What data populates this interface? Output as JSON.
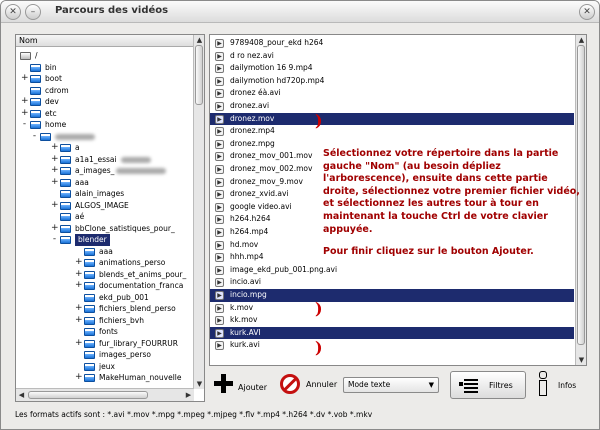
{
  "window": {
    "title": "Parcours des vidéos"
  },
  "tree": {
    "header": "Nom",
    "items": [
      {
        "label": "/",
        "level": 0,
        "exp": "-",
        "root": true
      },
      {
        "label": "bin",
        "level": 1,
        "exp": ""
      },
      {
        "label": "boot",
        "level": 1,
        "exp": "+"
      },
      {
        "label": "cdrom",
        "level": 1,
        "exp": ""
      },
      {
        "label": "dev",
        "level": 1,
        "exp": "+"
      },
      {
        "label": "etc",
        "level": 1,
        "exp": "+"
      },
      {
        "label": "home",
        "level": 1,
        "exp": "-"
      },
      {
        "label": "",
        "level": 2,
        "exp": "-",
        "blur": 40
      },
      {
        "label": "a",
        "level": 3,
        "exp": "+"
      },
      {
        "label": "a1a1_essai",
        "level": 3,
        "exp": "+",
        "blur": 30
      },
      {
        "label": "a_images_",
        "level": 3,
        "exp": "+",
        "blur": 50
      },
      {
        "label": "aaa",
        "level": 3,
        "exp": "+"
      },
      {
        "label": "alain_images",
        "level": 3,
        "exp": ""
      },
      {
        "label": "ALGOS_IMAGE",
        "level": 3,
        "exp": "+"
      },
      {
        "label": "aé",
        "level": 3,
        "exp": ""
      },
      {
        "label": "bbClone_satistiques_pour_",
        "level": 3,
        "exp": "+"
      },
      {
        "label": "blender",
        "level": 3,
        "exp": "-",
        "sel": true
      },
      {
        "label": "aaa",
        "level": 4,
        "exp": ""
      },
      {
        "label": "animations_perso",
        "level": 4,
        "exp": "+"
      },
      {
        "label": "blends_et_anims_pour_",
        "level": 4,
        "exp": "+"
      },
      {
        "label": "documentation_franca",
        "level": 4,
        "exp": "+"
      },
      {
        "label": "ekd_pub_001",
        "level": 4,
        "exp": ""
      },
      {
        "label": "fichiers_blend_perso",
        "level": 4,
        "exp": "+"
      },
      {
        "label": "fichiers_bvh",
        "level": 4,
        "exp": "+"
      },
      {
        "label": "fonts",
        "level": 4,
        "exp": ""
      },
      {
        "label": "fur_library_FOURRUR",
        "level": 4,
        "exp": "+"
      },
      {
        "label": "images_perso",
        "level": 4,
        "exp": ""
      },
      {
        "label": "jeux",
        "level": 4,
        "exp": ""
      },
      {
        "label": "MakeHuman_nouvelle",
        "level": 4,
        "exp": "+"
      }
    ]
  },
  "files": [
    {
      "name": "9789408_pour_ekd h264"
    },
    {
      "name": "d ro nez.avi"
    },
    {
      "name": "dailymotion 16 9.mp4"
    },
    {
      "name": "dailymotion hd720p.mp4"
    },
    {
      "name": "dronez éà.avi"
    },
    {
      "name": "dronez.avi"
    },
    {
      "name": "dronez.mov",
      "sel": true
    },
    {
      "name": "dronez.mp4"
    },
    {
      "name": "dronez.mpg"
    },
    {
      "name": "dronez_mov_001.mov"
    },
    {
      "name": "dronez_mov_002.mov"
    },
    {
      "name": "dronez_mov_9.mov"
    },
    {
      "name": "dronez_xvid.avi"
    },
    {
      "name": "google video.avi"
    },
    {
      "name": "h264.h264"
    },
    {
      "name": "h264.mp4"
    },
    {
      "name": "hd.mov"
    },
    {
      "name": "hhh.mp4"
    },
    {
      "name": "image_ekd_pub_001.png.avi"
    },
    {
      "name": "incio.avi"
    },
    {
      "name": "incio.mpg",
      "sel": true
    },
    {
      "name": "k.mov"
    },
    {
      "name": "kk.mov"
    },
    {
      "name": "kurk.AVI",
      "sel": true
    },
    {
      "name": "kurk.avi"
    }
  ],
  "overlay": {
    "p1": "Sélectionnez votre répertoire dans la partie gauche \"Nom\" (au besoin dépliez l'arborescence), ensuite dans cette partie droite, sélectionnez votre premier fichier vidéo, et sélectionnez les autres tour à tour en maintenant la touche Ctrl de votre clavier appuyée.",
    "p2": "Pour finir cliquez sur le bouton Ajouter."
  },
  "toolbar": {
    "add_label": "Ajouter",
    "cancel_label": "Annuler",
    "mode_value": "Mode texte",
    "filter_label": "Filtres",
    "info_label": "Infos"
  },
  "status": "Les formats actifs sont : *.avi *.mov *.mpg *.mpeg *.mjpeg *.flv *.mp4 *.h264 *.dv *.vob *.mkv",
  "colors": {
    "selection": "#1d2b6e",
    "overlay_text": "#a00000",
    "cancel": "#c41010"
  }
}
